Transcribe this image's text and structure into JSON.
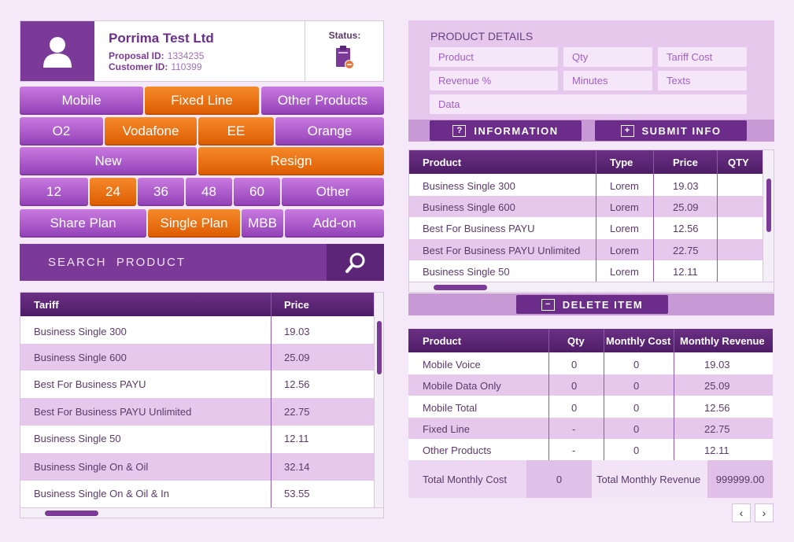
{
  "customer": {
    "name": "Porrima Test Ltd",
    "proposal_label": "Proposal ID:",
    "proposal_id": "1334235",
    "customer_label": "Customer ID:",
    "customer_id": "110399",
    "status_label": "Status:"
  },
  "options": {
    "row1": [
      "Mobile",
      "Fixed Line",
      "Other Products"
    ],
    "row2": [
      "O2",
      "Vodafone",
      "EE",
      "Orange"
    ],
    "row3": [
      "New",
      "Resign"
    ],
    "row4": [
      "12",
      "24",
      "36",
      "48",
      "60",
      "Other"
    ],
    "row5": [
      "Share Plan",
      "Single Plan",
      "MBB",
      "Add-on"
    ]
  },
  "search": {
    "label": "SEARCH  PRODUCT"
  },
  "tariff_table": {
    "headers": [
      "Tariff",
      "Price"
    ],
    "rows": [
      [
        "Business Single 300",
        "19.03"
      ],
      [
        "Business Single 600",
        "25.09"
      ],
      [
        "Best For Business PAYU",
        "12.56"
      ],
      [
        "Best For Business PAYU Unlimited",
        "22.75"
      ],
      [
        "Business Single 50",
        "12.11"
      ],
      [
        "Business Single On & Oil",
        "32.14"
      ],
      [
        "Business Single On & Oil & In",
        "53.55"
      ]
    ]
  },
  "product_details": {
    "title": "PRODUCT DETAILS",
    "fields": [
      "Product",
      "Qty",
      "Tariff Cost",
      "Revenue %",
      "Minutes",
      "Texts",
      "Data"
    ],
    "info_button": "INFORMATION",
    "submit_button": "SUBMIT INFO",
    "info_icon": "?",
    "submit_icon": "+"
  },
  "product_table": {
    "headers": [
      "Product",
      "Type",
      "Price",
      "QTY"
    ],
    "rows": [
      [
        "Business Single 300",
        "Lorem",
        "19.03",
        ""
      ],
      [
        "Business Single 600",
        "Lorem",
        "25.09",
        ""
      ],
      [
        "Best For Business PAYU",
        "Lorem",
        "12.56",
        ""
      ],
      [
        "Best For Business PAYU Unlimited",
        "Lorem",
        "22.75",
        ""
      ],
      [
        "Business Single 50",
        "Lorem",
        "12.11",
        ""
      ]
    ],
    "delete_button": "DELETE ITEM",
    "delete_icon": "−"
  },
  "summary_table": {
    "headers": [
      "Product",
      "Qty",
      "Monthly Cost",
      "Monthly Revenue"
    ],
    "rows": [
      [
        "Mobile Voice",
        "0",
        "0",
        "19.03"
      ],
      [
        "Mobile Data Only",
        "0",
        "0",
        "25.09"
      ],
      [
        "Mobile Total",
        "0",
        "0",
        "12.56"
      ],
      [
        "Fixed Line",
        "-",
        "0",
        "22.75"
      ],
      [
        "Other Products",
        "-",
        "0",
        "12.11"
      ]
    ],
    "total_cost_label": "Total Monthly Cost",
    "total_cost_value": "0",
    "total_revenue_label": "Total Monthly Revenue",
    "total_revenue_value": "999999.00"
  },
  "pager": {
    "prev": "‹",
    "next": "›"
  },
  "colors": {
    "brand_purple": "#7b3a98",
    "selected_orange": "#e86a0c",
    "row_alt": "#e6c8ec"
  }
}
